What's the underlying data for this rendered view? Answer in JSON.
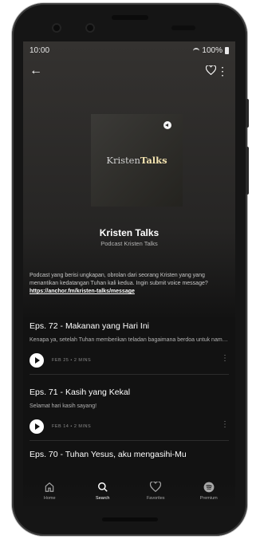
{
  "status_bar": {
    "time": "10:00",
    "battery": "100%"
  },
  "podcast": {
    "cover_text_1": "Kristen",
    "cover_text_2": "Talks",
    "title": "Kristen Talks",
    "subtitle": "Podcast Kristen Talks",
    "description": "Podcast yang berisi ungkapan, obrolan dari seorang Kristen yang yang menantikan kedatangan Tuhan kali kedua. Ingin submit voice message? ",
    "description_link": "https://anchor.fm/kristen-talks/message"
  },
  "episodes": [
    {
      "title": "Eps. 72 - Makanan yang Hari Ini",
      "description": "Kenapa ya, setelah Tuhan memberikan teladan bagaimana berdoa untuk nama Allah, kehendak Allah dan kerajaan Allah, ...",
      "meta": "FEB 25 • 2 MINS"
    },
    {
      "title": "Eps. 71 - Kasih yang Kekal",
      "description": "Selamat hari kasih sayang!",
      "meta": "FEB 14 • 2 MINS"
    },
    {
      "title": "Eps. 70 - Tuhan Yesus, aku mengasihi-Mu"
    }
  ],
  "bottom_nav": [
    {
      "label": "Home",
      "icon": "home-icon"
    },
    {
      "label": "Search",
      "icon": "search-icon",
      "active": true
    },
    {
      "label": "Favorites",
      "icon": "heart-icon"
    },
    {
      "label": "Premium",
      "icon": "spotify-icon"
    }
  ],
  "colors": {
    "background": "#121212",
    "text": "#ffffff",
    "secondary": "#b3b3b3"
  }
}
